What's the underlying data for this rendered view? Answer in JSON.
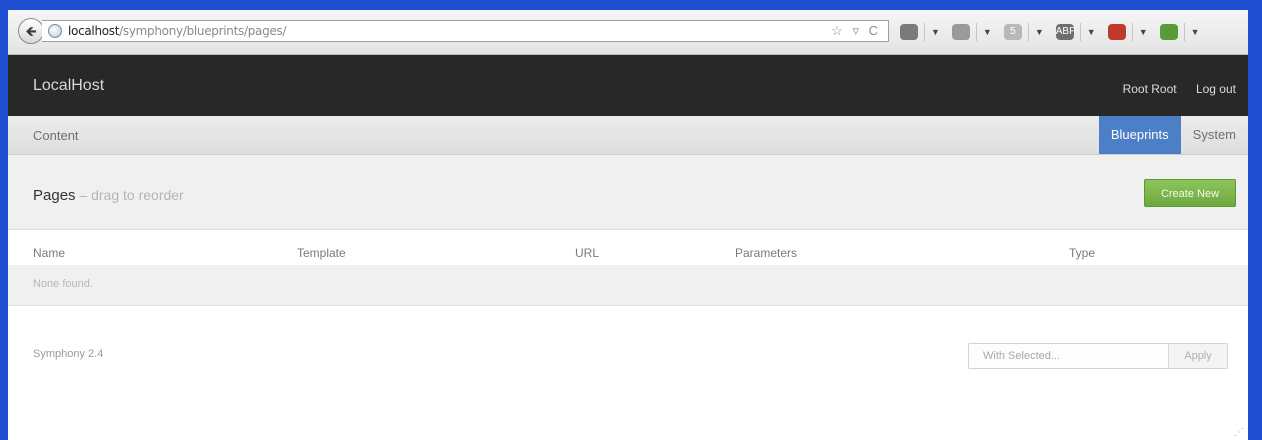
{
  "browser": {
    "back_glyph": "🡸",
    "url_host": "localhost",
    "url_path": "/symphony/blueprints/pages/",
    "url_tools": [
      "☆",
      "▿",
      "C"
    ]
  },
  "header": {
    "brand": "LocalHost",
    "user": "Root Root",
    "logout": "Log out"
  },
  "nav": {
    "content": "Content",
    "tabs": [
      {
        "label": "Blueprints",
        "active": true
      },
      {
        "label": "System",
        "active": false
      }
    ]
  },
  "context": {
    "title": "Pages",
    "hint": " – drag to reorder",
    "create_button": "Create New"
  },
  "table": {
    "columns": [
      "Name",
      "Template",
      "URL",
      "Parameters",
      "Type"
    ],
    "empty_message": "None found."
  },
  "footer": {
    "version": "Symphony 2.4",
    "with_selected": "With Selected...",
    "apply": "Apply"
  },
  "colors": {
    "header_bg": "#282828",
    "active_tab": "#4c7fc6",
    "create_button": "#7ab64a",
    "window_border": "#1f4fd0"
  },
  "extensions": [
    {
      "icon": "bug-icon",
      "label": "",
      "color": "#7a7a7a"
    },
    {
      "icon": "gear-icon",
      "label": "",
      "color": "#9a9a9a"
    },
    {
      "icon": "circle-5-icon",
      "label": "5",
      "color": "#b8b8b8"
    },
    {
      "icon": "abp-icon",
      "label": "ABP",
      "color": "#6e6e6e"
    },
    {
      "icon": "tool-icon",
      "label": "",
      "color": "#c0392b"
    },
    {
      "icon": "save-icon",
      "label": "",
      "color": "#5a9a3a"
    }
  ]
}
